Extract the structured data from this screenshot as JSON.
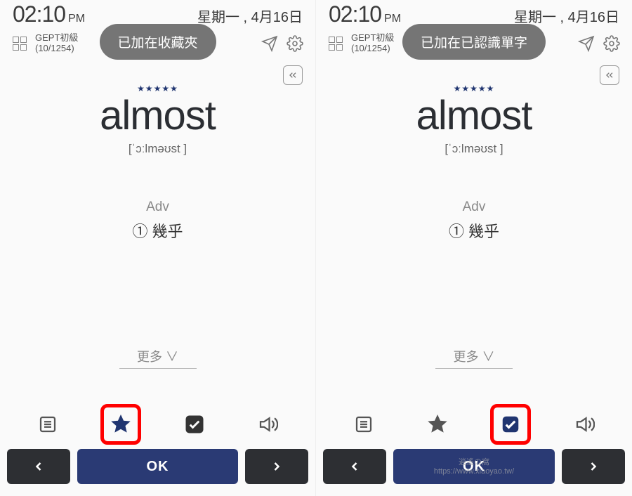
{
  "status": {
    "time": "02:10",
    "meridiem": "PM",
    "date": "星期一 , 4月16日"
  },
  "toolbar": {
    "deck_name": "GEPT初級",
    "progress": "(10/1254)"
  },
  "toast": {
    "left": "已加在收藏夾",
    "right": "已加在已認識單字"
  },
  "card": {
    "stars": "★★★★★",
    "word": "almost",
    "ipa": "[ˈɔːlməʊst ]",
    "pos": "Adv",
    "def": "① 幾乎",
    "more": "更多 ∨"
  },
  "buttons": {
    "ok": "OK"
  },
  "watermark": {
    "l1": "逍遙の窩",
    "l2": "https://www.xiaoyao.tw/"
  },
  "icons": {
    "grid": "grid-icon",
    "send": "send-icon",
    "gear": "gear-icon",
    "collapse": "collapse-icon",
    "list": "list-icon",
    "star": "star-icon",
    "check": "check-icon",
    "speaker": "speaker-icon",
    "prev": "chevron-left-icon",
    "next": "chevron-right-icon"
  }
}
